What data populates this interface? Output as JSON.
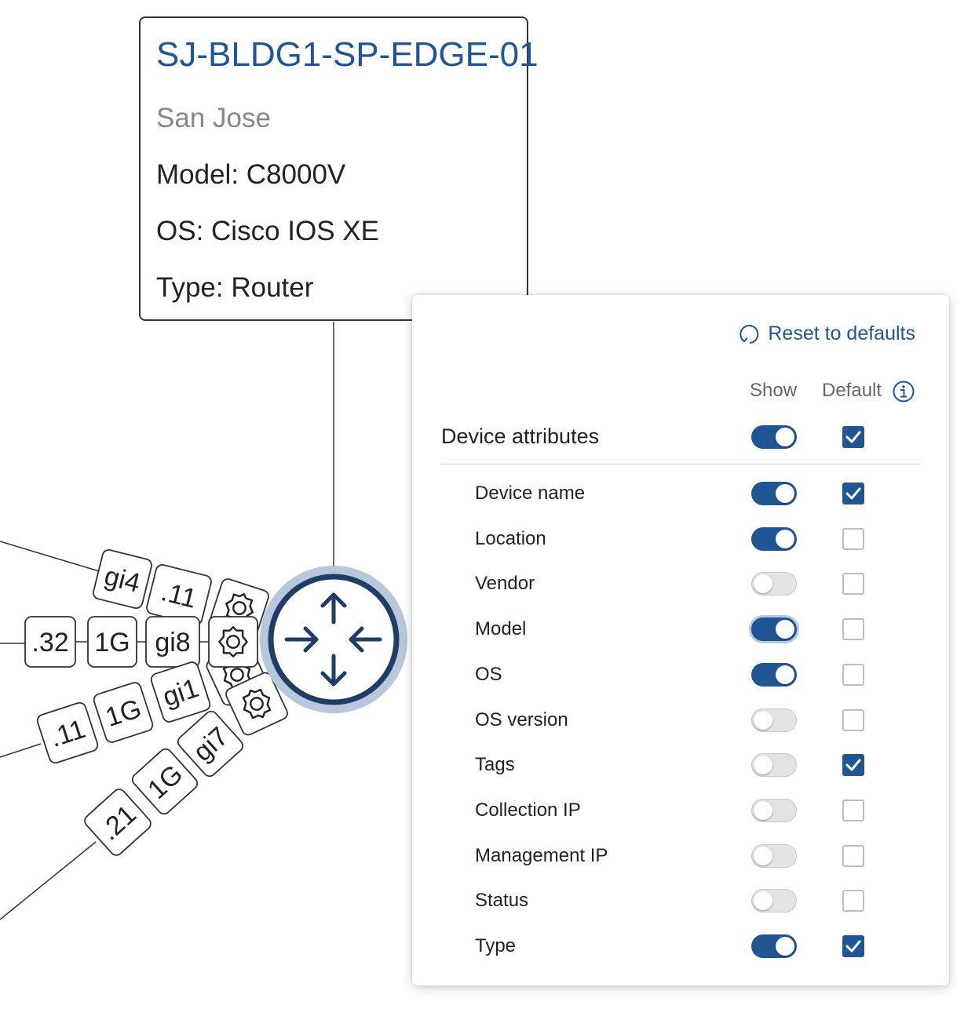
{
  "device_card": {
    "name": "SJ-BLDG1-SP-EDGE-01",
    "location": "San Jose",
    "model": "Model: C8000V",
    "os": "OS: Cisco IOS XE",
    "type": "Type: Router"
  },
  "topology": {
    "labels": [
      ".32",
      "1G",
      "gi8",
      "1G",
      "gi4",
      ".11",
      "1G",
      "gi1",
      ".21",
      "1G",
      "gi7"
    ],
    "center_icon": "router-icon"
  },
  "panel": {
    "reset_label": "Reset to defaults",
    "show_header": "Show",
    "default_header": "Default",
    "section": {
      "label": "Device attributes",
      "show": true,
      "default": true
    },
    "rows": [
      {
        "label": "Device name",
        "show": true,
        "default": true
      },
      {
        "label": "Location",
        "show": true,
        "default": false
      },
      {
        "label": "Vendor",
        "show": false,
        "default": false
      },
      {
        "label": "Model",
        "show": true,
        "default": false
      },
      {
        "label": "OS",
        "show": true,
        "default": false
      },
      {
        "label": "OS version",
        "show": false,
        "default": false
      },
      {
        "label": "Tags",
        "show": false,
        "default": true
      },
      {
        "label": "Collection IP",
        "show": false,
        "default": false
      },
      {
        "label": "Management IP",
        "show": false,
        "default": false
      },
      {
        "label": "Status",
        "show": false,
        "default": false
      },
      {
        "label": "Type",
        "show": true,
        "default": true
      }
    ]
  },
  "colors": {
    "accent": "#1f5693",
    "muted": "#888888",
    "ring": "#b7c7dc"
  }
}
